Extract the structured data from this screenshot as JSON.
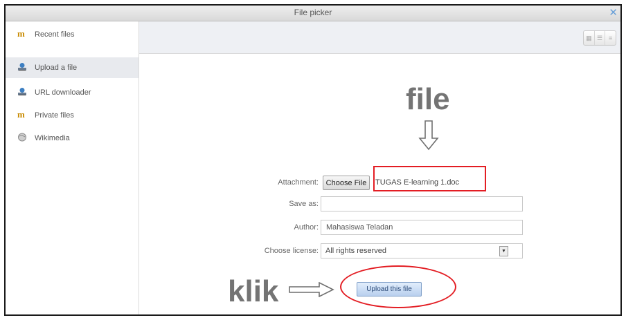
{
  "window": {
    "title": "File picker",
    "close_glyph": "✕"
  },
  "sidebar": {
    "items": [
      {
        "label": "Recent files",
        "icon": "moodle-icon"
      },
      {
        "label": "Upload a file",
        "icon": "upload-icon",
        "active": true
      },
      {
        "label": "URL downloader",
        "icon": "upload-icon"
      },
      {
        "label": "Private files",
        "icon": "moodle-icon"
      },
      {
        "label": "Wikimedia",
        "icon": "globe-icon"
      }
    ]
  },
  "toolbar": {
    "view_icons": [
      "grid-view-icon",
      "list-view-icon",
      "tree-view-icon"
    ]
  },
  "form": {
    "attachment_label": "Attachment:",
    "choose_file_label": "Choose File",
    "chosen_file": "TUGAS E-learning 1.doc",
    "save_as_label": "Save as:",
    "save_as_value": "",
    "author_label": "Author:",
    "author_value": "Mahasiswa Teladan",
    "license_label": "Choose license:",
    "license_value": "All rights reserved",
    "upload_button": "Upload this file"
  },
  "annotations": {
    "file_text": "file",
    "klik_text": "klik",
    "highlight_color": "#e31d23"
  }
}
